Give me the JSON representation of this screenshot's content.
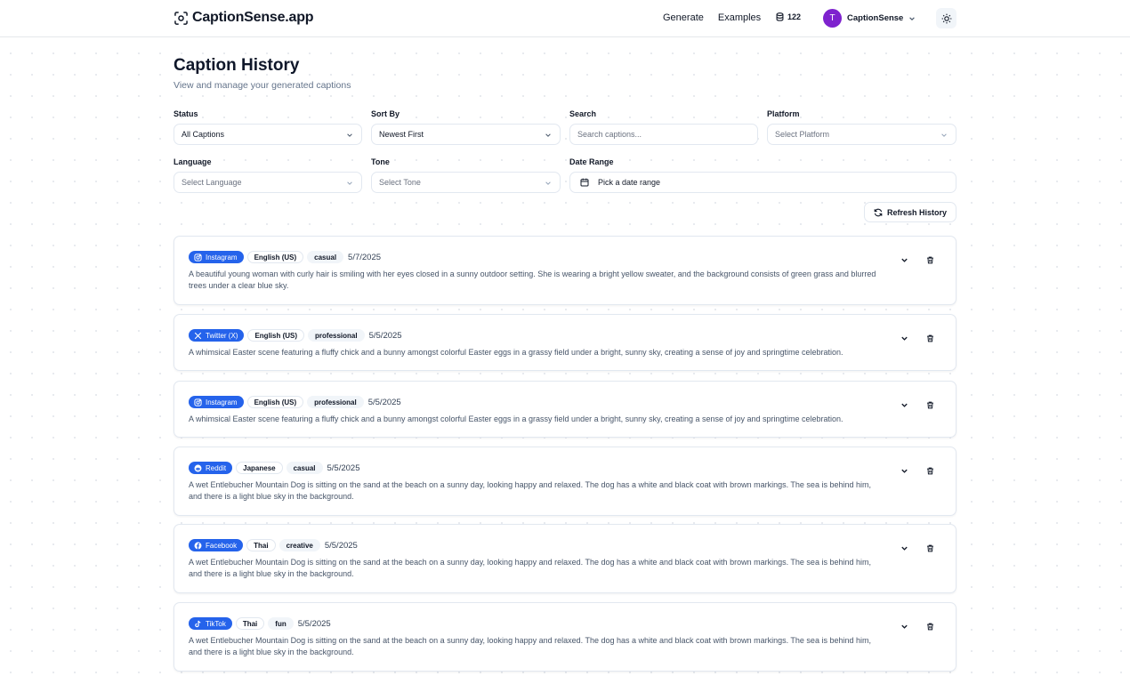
{
  "header": {
    "brand": "CaptionSense.app",
    "nav": [
      "Generate",
      "Examples"
    ],
    "credits": "122",
    "user": {
      "initial": "T",
      "name": "CaptionSense"
    }
  },
  "page": {
    "title": "Caption History",
    "subtitle": "View and manage your generated captions"
  },
  "filters": {
    "status": {
      "label": "Status",
      "value": "All Captions"
    },
    "sort": {
      "label": "Sort By",
      "value": "Newest First"
    },
    "search": {
      "label": "Search",
      "placeholder": "Search captions..."
    },
    "platform": {
      "label": "Platform",
      "placeholder": "Select Platform"
    },
    "language": {
      "label": "Language",
      "placeholder": "Select Language"
    },
    "tone": {
      "label": "Tone",
      "placeholder": "Select Tone"
    },
    "date_range": {
      "label": "Date Range",
      "placeholder": "Pick a date range"
    }
  },
  "refresh_label": "Refresh History",
  "captions": [
    {
      "platform": "Instagram",
      "platform_icon": "instagram-icon",
      "language": "English (US)",
      "tone": "casual",
      "date": "5/7/2025",
      "text": "A beautiful young woman with curly hair is smiling with her eyes closed in a sunny outdoor setting. She is wearing a bright yellow sweater, and the background consists of green grass and blurred trees under a clear blue sky."
    },
    {
      "platform": "Twitter (X)",
      "platform_icon": "x-icon",
      "language": "English (US)",
      "tone": "professional",
      "date": "5/5/2025",
      "text": "A whimsical Easter scene featuring a fluffy chick and a bunny amongst colorful Easter eggs in a grassy field under a bright, sunny sky, creating a sense of joy and springtime celebration."
    },
    {
      "platform": "Instagram",
      "platform_icon": "instagram-icon",
      "language": "English (US)",
      "tone": "professional",
      "date": "5/5/2025",
      "text": "A whimsical Easter scene featuring a fluffy chick and a bunny amongst colorful Easter eggs in a grassy field under a bright, sunny sky, creating a sense of joy and springtime celebration."
    },
    {
      "platform": "Reddit",
      "platform_icon": "reddit-icon",
      "language": "Japanese",
      "tone": "casual",
      "date": "5/5/2025",
      "text": "A wet Entlebucher Mountain Dog is sitting on the sand at the beach on a sunny day, looking happy and relaxed. The dog has a white and black coat with brown markings. The sea is behind him, and there is a light blue sky in the background."
    },
    {
      "platform": "Facebook",
      "platform_icon": "facebook-icon",
      "language": "Thai",
      "tone": "creative",
      "date": "5/5/2025",
      "text": "A wet Entlebucher Mountain Dog is sitting on the sand at the beach on a sunny day, looking happy and relaxed. The dog has a white and black coat with brown markings. The sea is behind him, and there is a light blue sky in the background."
    },
    {
      "platform": "TikTok",
      "platform_icon": "tiktok-icon",
      "language": "Thai",
      "tone": "fun",
      "date": "5/5/2025",
      "text": "A wet Entlebucher Mountain Dog is sitting on the sand at the beach on a sunny day, looking happy and relaxed. The dog has a white and black coat with brown markings. The sea is behind him, and there is a light blue sky in the background."
    }
  ],
  "colors": {
    "accent": "#2563eb",
    "avatar": "#7e22ce",
    "border": "#e2e8f0"
  }
}
